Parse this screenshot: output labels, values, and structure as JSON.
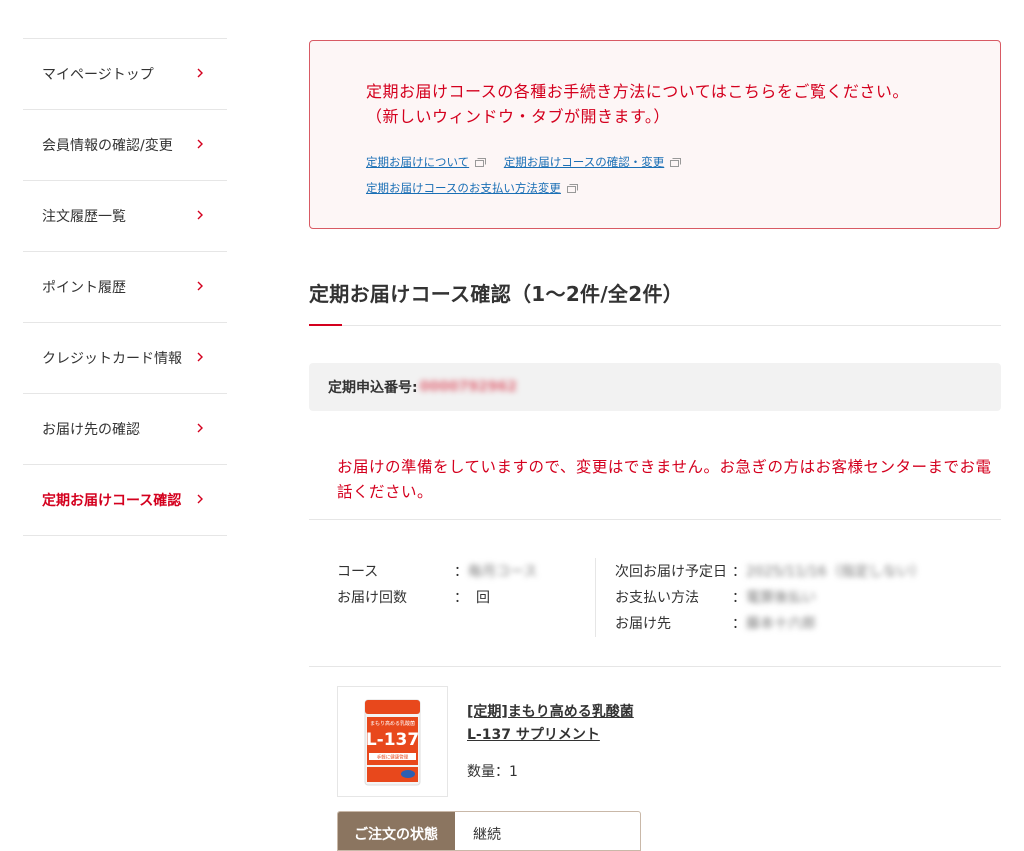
{
  "sidebar": {
    "items": [
      {
        "label": "マイページトップ"
      },
      {
        "label": "会員情報の確認/変更"
      },
      {
        "label": "注文履歴一覧"
      },
      {
        "label": "ポイント履歴"
      },
      {
        "label": "クレジットカード情報"
      },
      {
        "label": "お届け先の確認"
      },
      {
        "label": "定期お届けコース確認"
      }
    ],
    "active_index": 6
  },
  "notice": {
    "line1": "定期お届けコースの各種お手続き方法についてはこちらをご覧ください。",
    "line2": "（新しいウィンドウ・タブが開きます。）",
    "links": [
      {
        "label": "定期お届けについて"
      },
      {
        "label": "定期お届けコースの確認・変更"
      },
      {
        "label": "定期お届けコースのお支払い方法変更"
      }
    ]
  },
  "page_title": "定期お届けコース確認（1～2件/全2件）",
  "application": {
    "label": "定期申込番号:",
    "number": "0000792962"
  },
  "warning": "お届けの準備をしていますので、変更はできません。お急ぎの方はお客様センターまでお電話ください。",
  "details": {
    "left": [
      {
        "label": "コース",
        "sep": "：",
        "value": "毎月コース"
      },
      {
        "label": "お届け回数",
        "sep": "：",
        "value": "回"
      }
    ],
    "right": [
      {
        "label": "次回お届け予定日",
        "sep": "：",
        "value": "2025/11/16（指定しない）"
      },
      {
        "label": "お支払い方法",
        "sep": "：",
        "value": "電算後払い"
      },
      {
        "label": "お届け先",
        "sep": "：",
        "value": "藤本十六郎"
      }
    ]
  },
  "product": {
    "name_line1": "[定期]まもり高める乳酸菌",
    "name_line2": "L-137 サプリメント",
    "quantity": "数量：1",
    "package_tagline": "まもり高める乳酸菌",
    "package_brand": "L-137",
    "package_note": "手軽に健康管理"
  },
  "order_status": {
    "label": "ご注文の状態",
    "value": "継続"
  },
  "colors": {
    "accent_red": "#d4001e",
    "link_blue": "#1a6fb5",
    "status_brown": "#8b7560"
  }
}
